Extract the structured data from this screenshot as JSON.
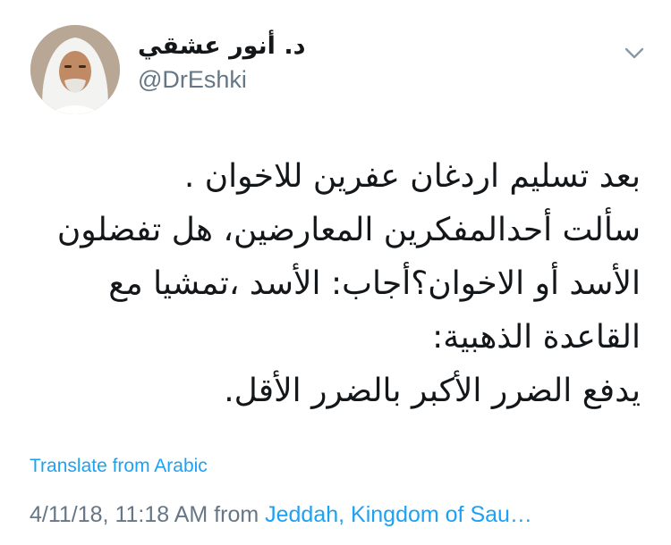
{
  "user": {
    "display_name": "د. أنور عشقي",
    "handle": "@DrEshki"
  },
  "tweet": {
    "lines": [
      "بعد تسليم اردغان عفرين للاخوان .",
      "سألت أحدالمفكرين المعارضين، هل تفضلون",
      "الأسد أو الاخوان؟أجاب: الأسد ،تمشيا مع",
      "القاعدة الذهبية:",
      "يدفع الضرر الأكبر بالضرر الأقل."
    ]
  },
  "translate_label": "Translate from Arabic",
  "meta": {
    "timestamp": "4/11/18, 11:18 AM",
    "from": "from",
    "location": "Jeddah, Kingdom of Sau…"
  },
  "colors": {
    "link": "#1da1f2",
    "secondary": "#657786",
    "text": "#14171a"
  },
  "icons": {
    "menu": "chevron-down-icon",
    "avatar": "avatar"
  }
}
